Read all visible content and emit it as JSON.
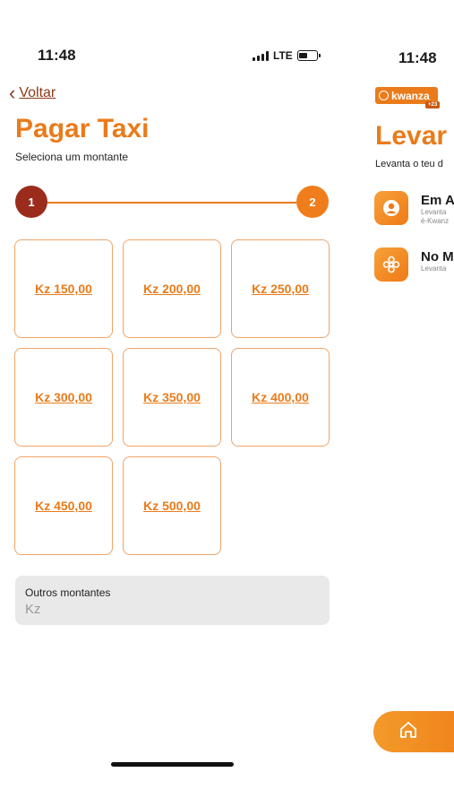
{
  "left": {
    "status": {
      "time": "11:48",
      "network": "LTE"
    },
    "nav": {
      "back_label": "Voltar"
    },
    "title": "Pagar Taxi",
    "subtitle": "Seleciona um montante",
    "stepper": {
      "step1": "1",
      "step2": "2"
    },
    "amounts": [
      "Kz 150,00",
      "Kz 200,00",
      "Kz 250,00",
      "Kz 300,00",
      "Kz 350,00",
      "Kz 400,00",
      "Kz 450,00",
      "Kz 500,00"
    ],
    "other": {
      "label": "Outros montantes",
      "placeholder": "Kz"
    }
  },
  "right": {
    "status": {
      "time": "11:48"
    },
    "logo_text": "kwanza",
    "logo_badge": "+23",
    "title": "Levar",
    "subtitle": "Levanta o teu d",
    "options": [
      {
        "title": "Em A",
        "desc_line1": "Levanta",
        "desc_line2": "é-Kwanz",
        "icon": "person-icon"
      },
      {
        "title": "No M",
        "desc_line1": "Levanta",
        "icon": "flower-icon"
      }
    ],
    "bottom_icon": "home-icon"
  },
  "colors": {
    "accent": "#ea7b1a",
    "step_active": "#9b2c1c",
    "back_link": "#8a3a1a"
  }
}
